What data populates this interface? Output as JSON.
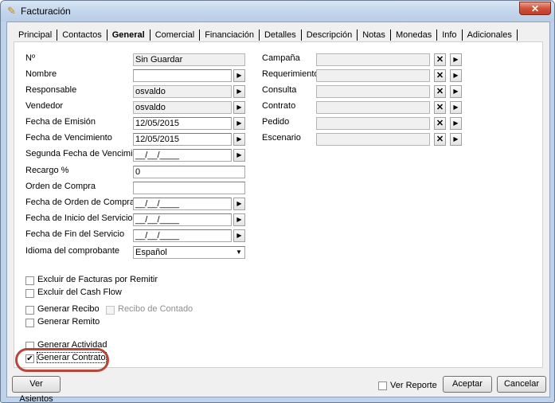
{
  "window": {
    "title": "Facturación",
    "close_symbol": "✕"
  },
  "tabs": [
    "Principal",
    "Contactos",
    "General",
    "Comercial",
    "Financiación",
    "Detalles",
    "Descripción",
    "Notas",
    "Monedas",
    "Info",
    "Adicionales"
  ],
  "active_tab": "General",
  "left_fields": [
    {
      "label": "Nº",
      "value": "Sin Guardar"
    },
    {
      "label": "Nombre",
      "value": ""
    },
    {
      "label": "Responsable",
      "value": "osvaldo"
    },
    {
      "label": "Vendedor",
      "value": "osvaldo"
    },
    {
      "label": "Fecha de Emisión",
      "value": "12/05/2015"
    },
    {
      "label": "Fecha de Vencimiento",
      "value": "12/05/2015"
    },
    {
      "label": "Segunda Fecha de Vencimiento",
      "value": "__/__/____"
    },
    {
      "label": "Recargo %",
      "value": "0"
    },
    {
      "label": "Orden de Compra",
      "value": ""
    },
    {
      "label": "Fecha de Orden de Compra",
      "value": "__/__/____"
    },
    {
      "label": "Fecha de Inicio del Servicio",
      "value": "__/__/____"
    },
    {
      "label": "Fecha de Fin del Servicio",
      "value": "__/__/____"
    },
    {
      "label": "Idioma del comprobante",
      "value": "Español"
    }
  ],
  "right_fields": [
    {
      "label": "Campaña",
      "value": ""
    },
    {
      "label": "Requerimiento",
      "value": ""
    },
    {
      "label": "Consulta",
      "value": ""
    },
    {
      "label": "Contrato",
      "value": ""
    },
    {
      "label": "Pedido",
      "value": ""
    },
    {
      "label": "Escenario",
      "value": ""
    }
  ],
  "checkboxes": {
    "excluir_facturas": {
      "label": "Excluir de Facturas por Remitir",
      "checked": false
    },
    "excluir_cash_flow": {
      "label": "Excluir del Cash Flow",
      "checked": false
    },
    "generar_recibo": {
      "label": "Generar Recibo",
      "checked": false
    },
    "recibo_contado": {
      "label": "Recibo de Contado",
      "checked": false,
      "enabled": false
    },
    "generar_remito": {
      "label": "Generar Remito",
      "checked": false
    },
    "generar_actividad": {
      "label": "Generar Actividad",
      "checked": false
    },
    "generar_contrato": {
      "label": "Generar Contrato",
      "checked": true
    },
    "ver_reporte": {
      "label": "Ver Reporte",
      "checked": false
    }
  },
  "buttons": {
    "ver_asientos": "Ver Asientos",
    "aceptar": "Aceptar",
    "cancelar": "Cancelar"
  },
  "glyphs": {
    "arrow": "▶",
    "clear": "✕",
    "dropdown": "▼",
    "check": "✔"
  },
  "colors": {
    "highlight_circle": "#b8463a",
    "title_bar": "#c2d5ec"
  }
}
